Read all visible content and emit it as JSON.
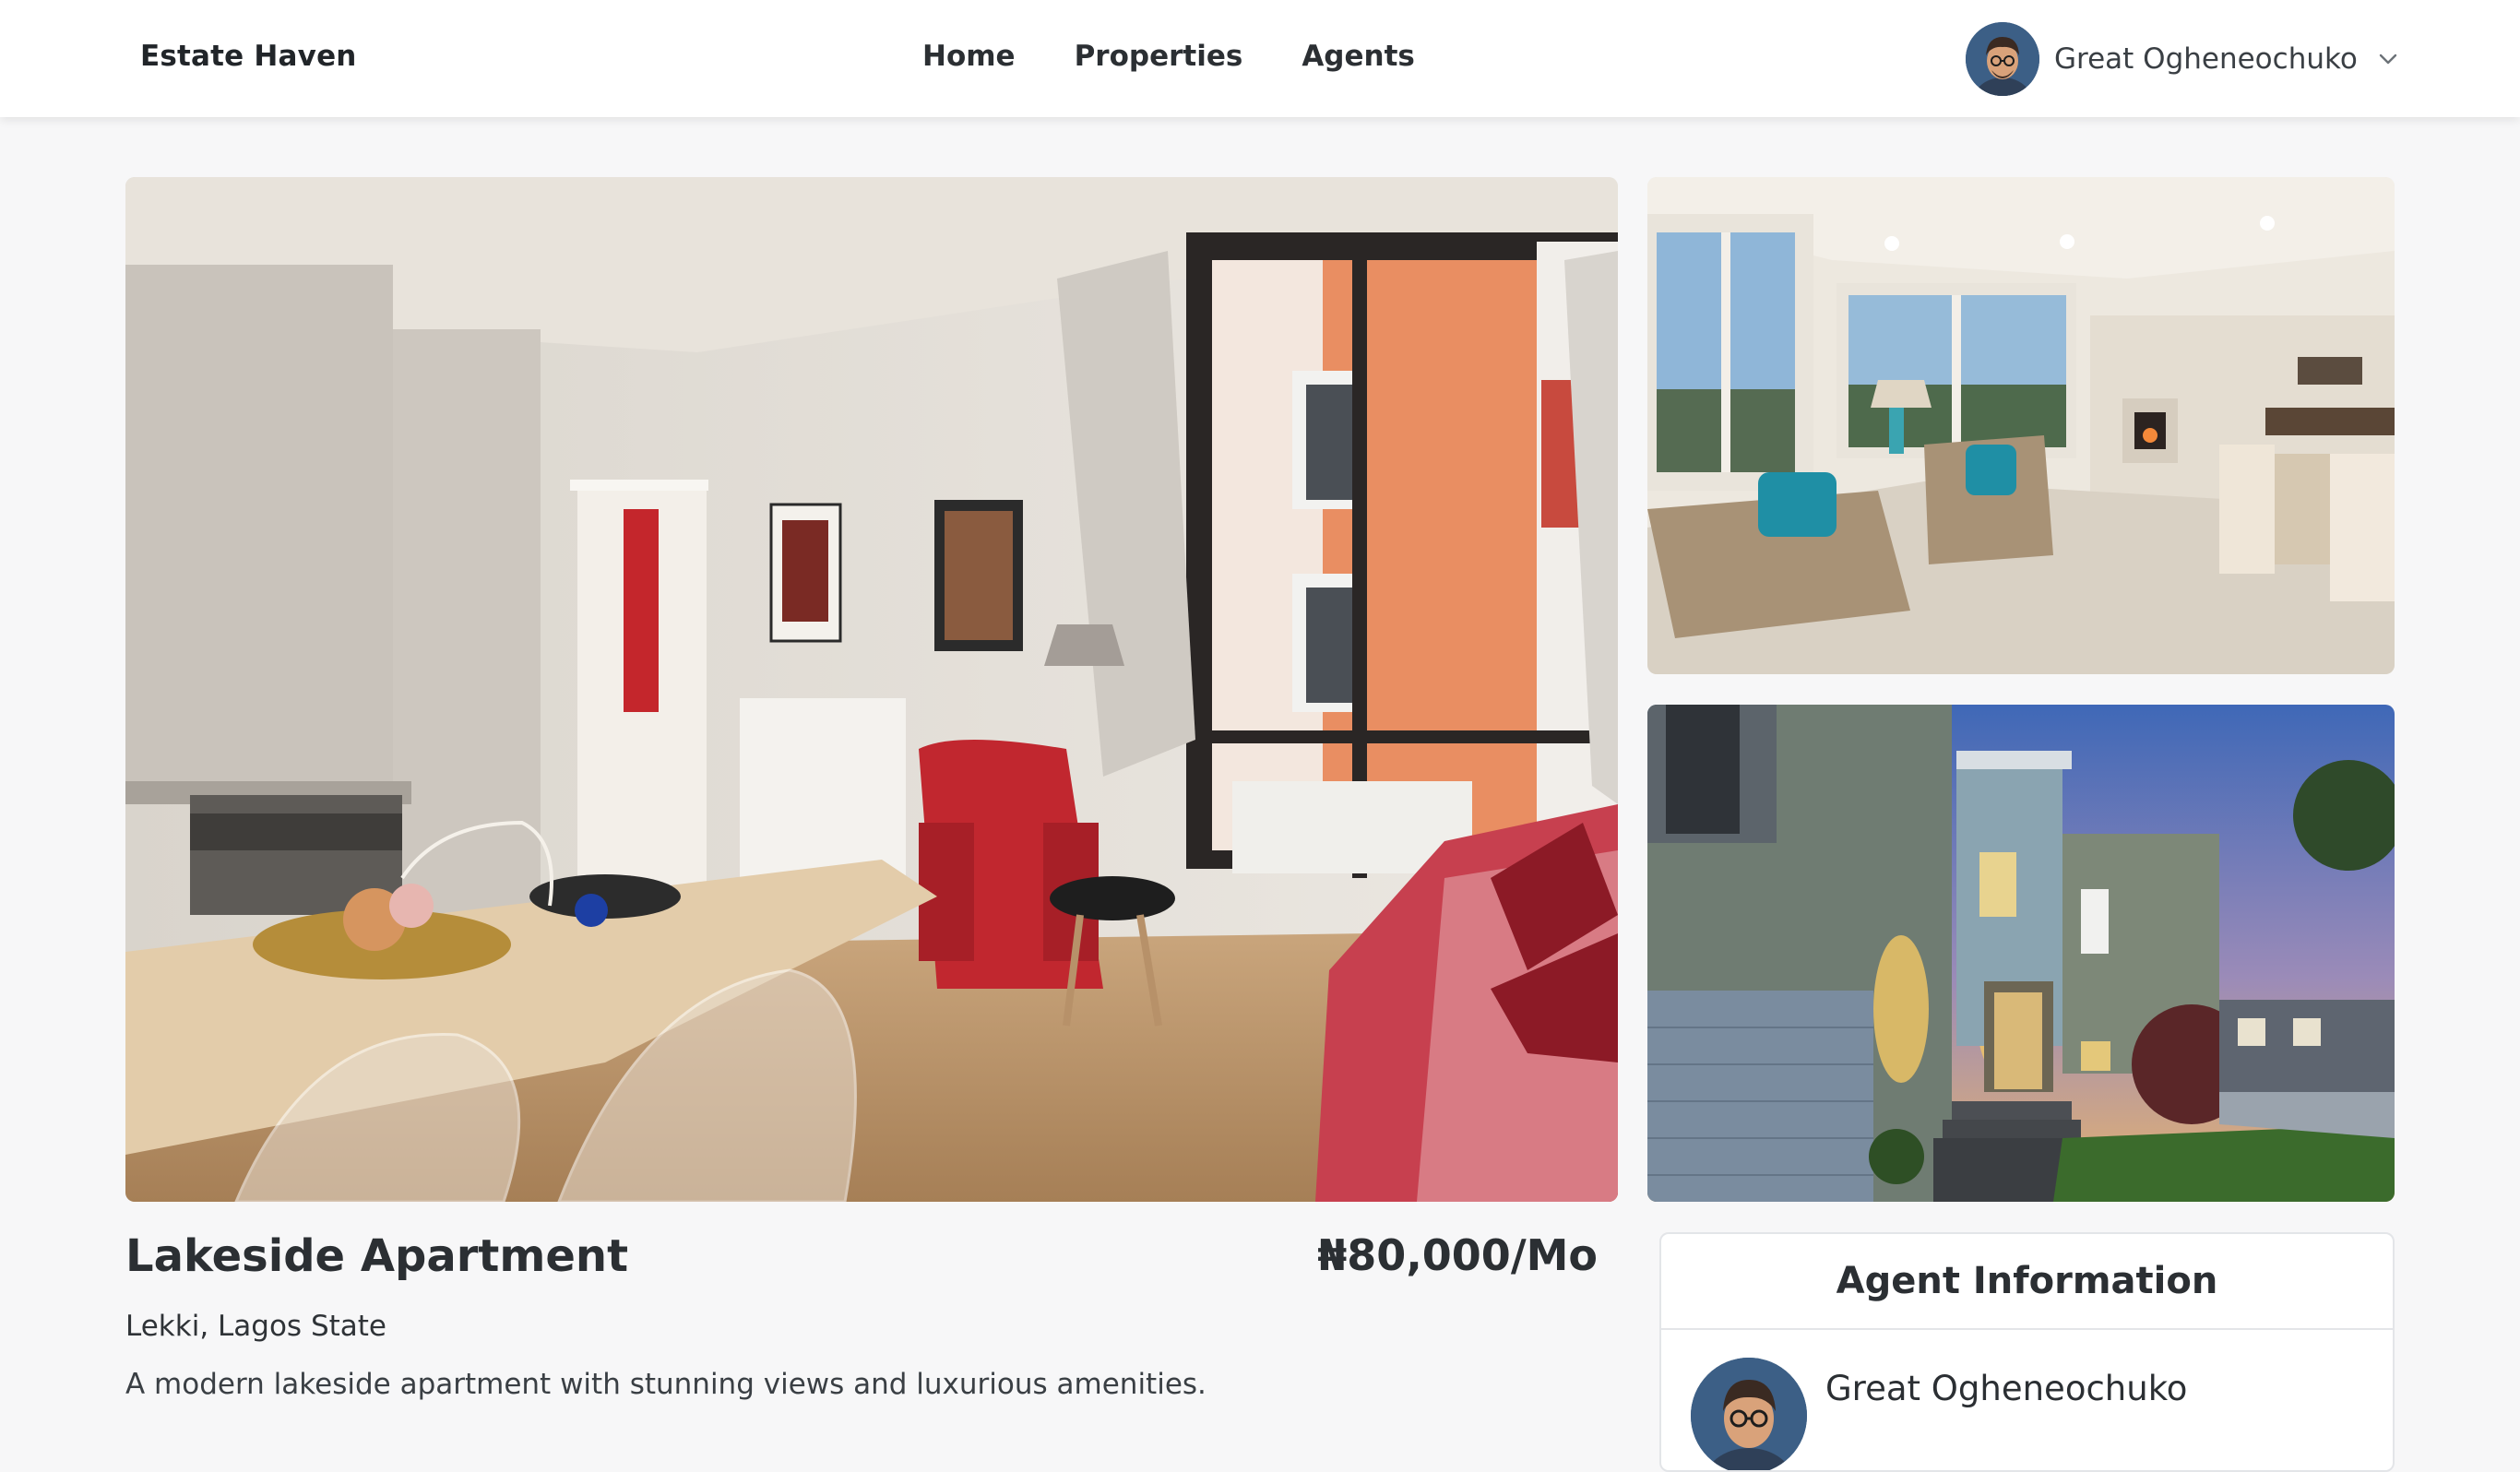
{
  "brand": "Estate Haven",
  "nav": {
    "links": [
      {
        "label": "Home"
      },
      {
        "label": "Properties"
      },
      {
        "label": "Agents"
      }
    ]
  },
  "user": {
    "name": "Great Ogheneochuko"
  },
  "property": {
    "title": "Lakeside Apartment",
    "price": "₦80,000/Mo",
    "location": "Lekki, Lagos State",
    "description": "A modern lakeside apartment with stunning views and luxurious amenities."
  },
  "agent": {
    "heading": "Agent Information",
    "name": "Great Ogheneochuko"
  },
  "icons": {
    "user_menu": "chevron-down-icon"
  },
  "colors": {
    "navbar_bg": "#ffffff",
    "page_bg": "#f7f7f8",
    "text_primary": "#2b2f33"
  }
}
